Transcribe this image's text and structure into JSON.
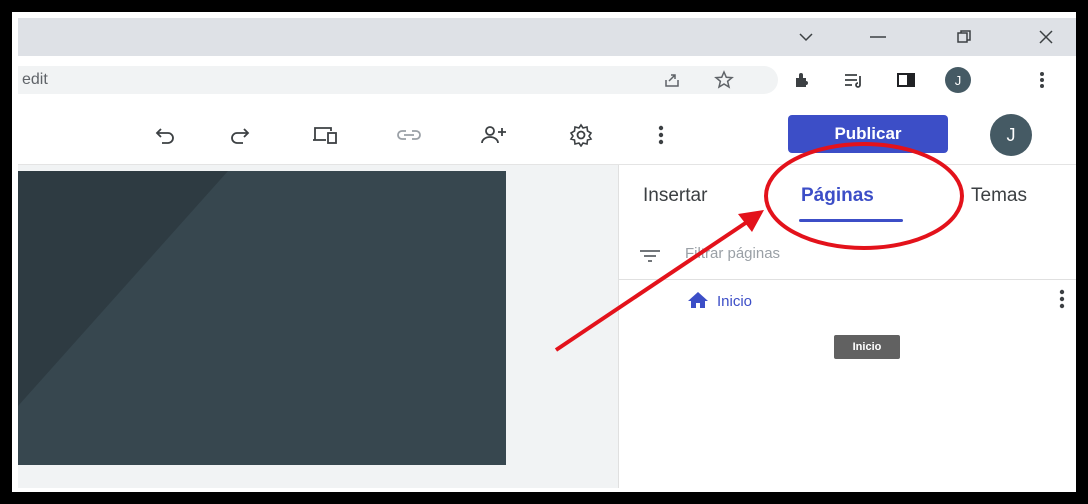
{
  "browser": {
    "url_fragment": "edit",
    "window_controls": [
      "chevron-down-icon",
      "minimize-icon",
      "restore-icon",
      "close-icon"
    ],
    "toolbar_icons": [
      "share-icon",
      "star-icon",
      "extensions-icon",
      "reading-list-icon",
      "side-panel-icon",
      "profile-avatar",
      "menu-dots-icon"
    ],
    "profile_initial": "J"
  },
  "sites_toolbar": {
    "icons": [
      "undo-icon",
      "redo-icon",
      "preview-icon",
      "link-icon",
      "share-person-icon",
      "settings-icon",
      "more-icon"
    ],
    "publish_label": "Publicar",
    "avatar_initial": "J",
    "accent_color": "#3c4ec7"
  },
  "panel": {
    "tabs": [
      {
        "label": "Insertar",
        "active": false
      },
      {
        "label": "Páginas",
        "active": true
      },
      {
        "label": "Temas",
        "active": false
      }
    ],
    "filter_placeholder": "Filtrar páginas",
    "pages": [
      {
        "label": "Inicio",
        "icon": "home-icon"
      }
    ],
    "tooltip": "Inicio"
  },
  "annotation": {
    "highlight_color": "#e3121b",
    "target": "Páginas"
  }
}
